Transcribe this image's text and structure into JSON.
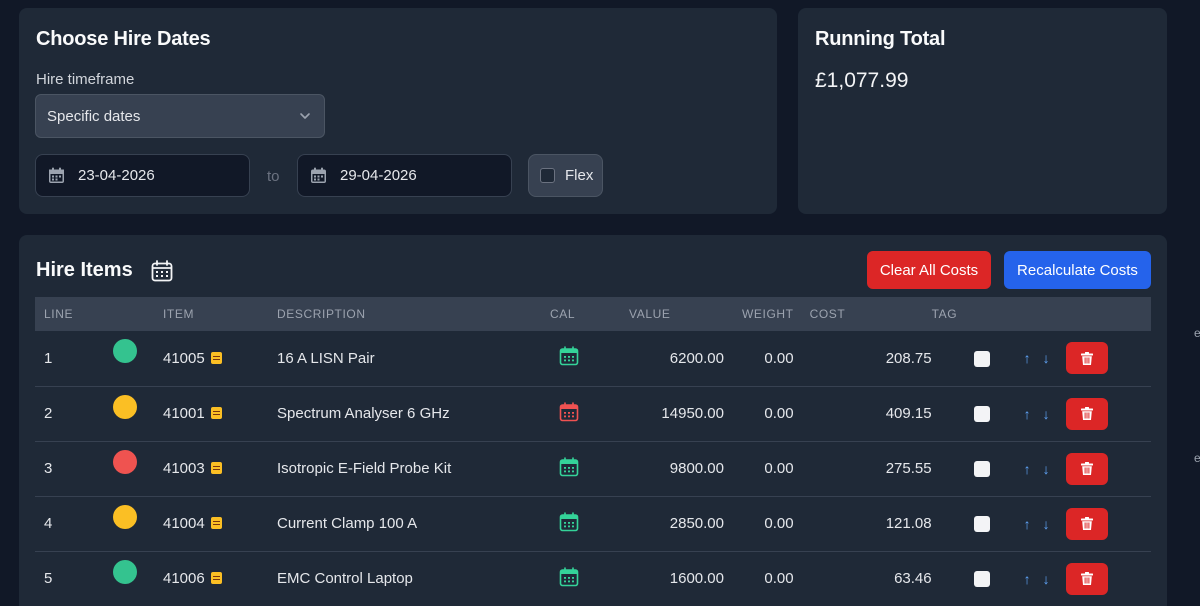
{
  "dates_card": {
    "title": "Choose Hire Dates",
    "timeframe_label": "Hire timeframe",
    "timeframe_value": "Specific dates",
    "date_from": "23-04-2026",
    "to_label": "to",
    "date_to": "29-04-2026",
    "flex_label": "Flex"
  },
  "total_card": {
    "title": "Running Total",
    "value": "£1,077.99"
  },
  "items_card": {
    "title": "Hire Items",
    "clear_label": "Clear All Costs",
    "recalc_label": "Recalculate Costs",
    "columns": [
      "LINE",
      "ITEM",
      "DESCRIPTION",
      "CAL",
      "VALUE",
      "WEIGHT",
      "COST",
      "TAG"
    ],
    "rows": [
      {
        "line": "1",
        "status_color": "#34c38f",
        "item": "41005",
        "description": "16 A LISN Pair",
        "cal_color": "#34d399",
        "value": "6200.00",
        "weight": "0.00",
        "cost": "208.75"
      },
      {
        "line": "2",
        "status_color": "#fbbf24",
        "item": "41001",
        "description": "Spectrum Analyser 6 GHz",
        "cal_color": "#f05252",
        "value": "14950.00",
        "weight": "0.00",
        "cost": "409.15"
      },
      {
        "line": "3",
        "status_color": "#ef5350",
        "item": "41003",
        "description": "Isotropic E-Field Probe Kit",
        "cal_color": "#34d399",
        "value": "9800.00",
        "weight": "0.00",
        "cost": "275.55"
      },
      {
        "line": "4",
        "status_color": "#fbbf24",
        "item": "41004",
        "description": "Current Clamp 100 A",
        "cal_color": "#34d399",
        "value": "2850.00",
        "weight": "0.00",
        "cost": "121.08"
      },
      {
        "line": "5",
        "status_color": "#34c38f",
        "item": "41006",
        "description": "EMC Control Laptop",
        "cal_color": "#34d399",
        "value": "1600.00",
        "weight": "0.00",
        "cost": "63.46"
      }
    ]
  },
  "edge_fragments": [
    "ex",
    "eo"
  ]
}
